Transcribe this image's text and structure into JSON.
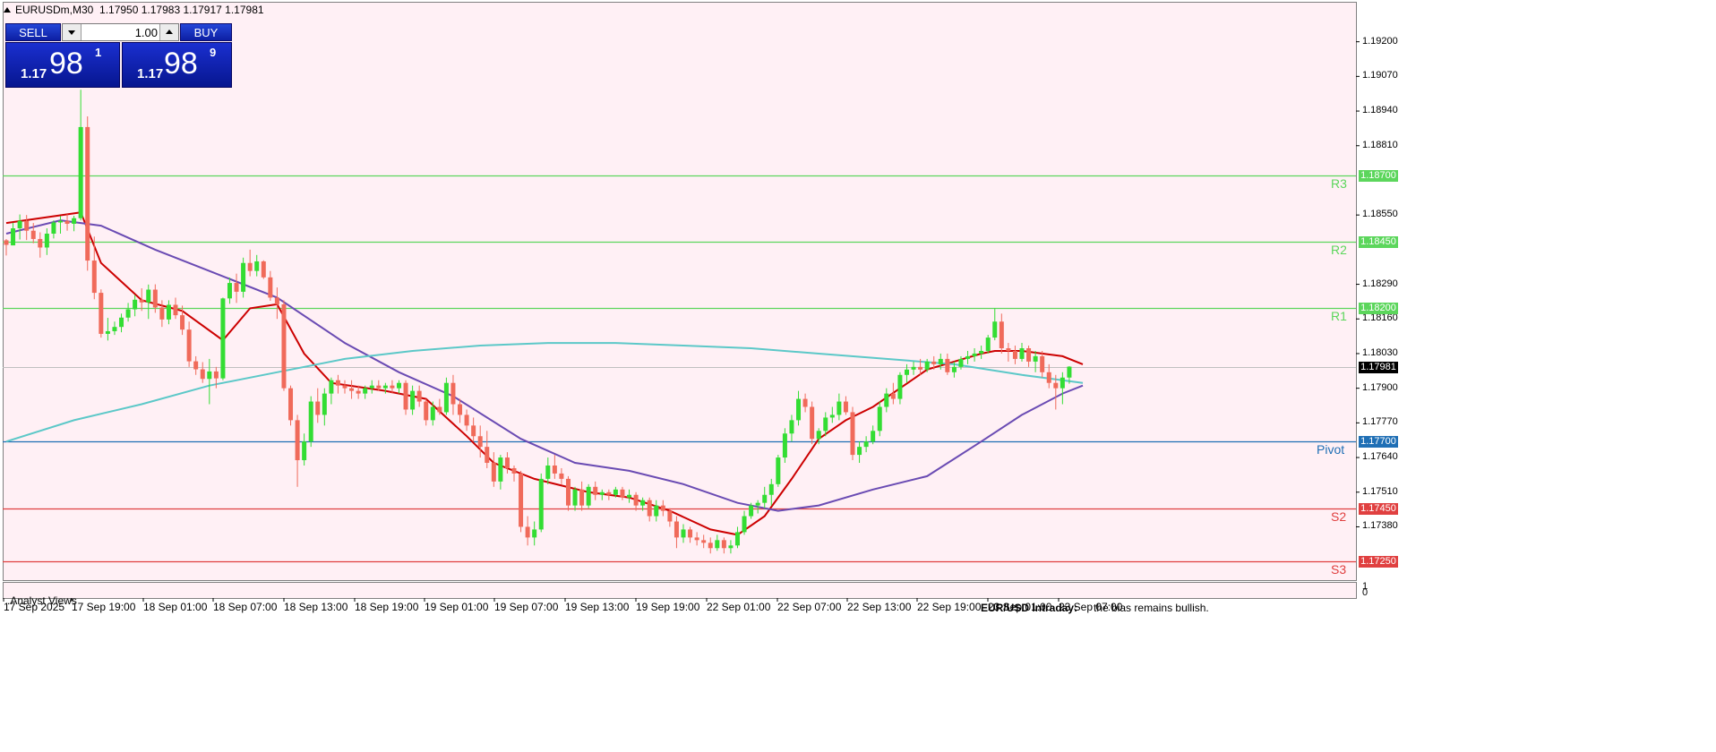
{
  "header": {
    "symbol": "EURUSDm,M30",
    "ohlc": "1.17950 1.17983 1.17917 1.17981"
  },
  "trade_panel": {
    "sell_label": "SELL",
    "buy_label": "BUY",
    "lot_value": "1.00",
    "sell_prefix": "1.17",
    "sell_big": "98",
    "sell_sup": "1",
    "buy_prefix": "1.17",
    "buy_big": "98",
    "buy_sup": "9"
  },
  "y_axis": {
    "ticks": [
      "1.19200",
      "1.19070",
      "1.18940",
      "1.18810",
      "1.18550",
      "1.18290",
      "1.18160",
      "1.18030",
      "1.17900",
      "1.17770",
      "1.17640",
      "1.17510",
      "1.17380"
    ],
    "current_price": "1.17981",
    "sub_ticks": [
      "1",
      "0"
    ]
  },
  "levels": [
    {
      "name": "R3",
      "price": "1.18700",
      "value": 1.187,
      "color": "#5cd65c"
    },
    {
      "name": "R2",
      "price": "1.18450",
      "value": 1.1845,
      "color": "#5cd65c"
    },
    {
      "name": "R1",
      "price": "1.18200",
      "value": 1.182,
      "color": "#5cd65c"
    },
    {
      "name": "Pivot",
      "price": "1.17700",
      "value": 1.177,
      "color": "#1f6fb5"
    },
    {
      "name": "S2",
      "price": "1.17450",
      "value": 1.1745,
      "color": "#e04040"
    },
    {
      "name": "S3",
      "price": "1.17250",
      "value": 1.1725,
      "color": "#e04040"
    }
  ],
  "x_axis": {
    "ticks": [
      "17 Sep 2025",
      "17 Sep 19:00",
      "18 Sep 01:00",
      "18 Sep 07:00",
      "18 Sep 13:00",
      "18 Sep 19:00",
      "19 Sep 01:00",
      "19 Sep 07:00",
      "19 Sep 13:00",
      "19 Sep 19:00",
      "22 Sep 01:00",
      "22 Sep 07:00",
      "22 Sep 13:00",
      "22 Sep 19:00",
      "23 Sep 01:00",
      "23 Sep 07:00"
    ]
  },
  "subwindow": {
    "title": ".Analyst Views",
    "news_title": "EUR/USD Intraday:",
    "news_text": "the bias remains bullish."
  },
  "colors": {
    "background": "#fff0f5",
    "bull": "#33dd33",
    "bear": "#f06a5a",
    "ma_fast": "#cc0000",
    "ma_mid": "#6a4bb3",
    "ma_slow": "#5cc8c8",
    "grid": "#c0c0c0"
  },
  "chart_data": {
    "type": "candlestick",
    "symbol": "EURUSDm",
    "timeframe": "M30",
    "ylim": [
      1.1718,
      1.1935
    ],
    "candles": [
      [
        1.18455,
        1.1846,
        1.18398,
        1.18438
      ],
      [
        1.18436,
        1.18521,
        1.18436,
        1.185
      ],
      [
        1.185,
        1.18552,
        1.18458,
        1.18528
      ],
      [
        1.18528,
        1.1855,
        1.18456,
        1.18491
      ],
      [
        1.18491,
        1.1852,
        1.18444,
        1.1846
      ],
      [
        1.1846,
        1.18485,
        1.1839,
        1.18428
      ],
      [
        1.18428,
        1.185,
        1.184,
        1.1848
      ],
      [
        1.1848,
        1.1853,
        1.18462,
        1.18522
      ],
      [
        1.18522,
        1.18546,
        1.1848,
        1.18528
      ],
      [
        1.18528,
        1.18553,
        1.18491,
        1.18517
      ],
      [
        1.18517,
        1.18547,
        1.18489,
        1.18538
      ],
      [
        1.18538,
        1.1902,
        1.1853,
        1.1888
      ],
      [
        1.1888,
        1.1892,
        1.18341,
        1.18379
      ],
      [
        1.18379,
        1.18469,
        1.18234,
        1.18258
      ],
      [
        1.18258,
        1.18271,
        1.1809,
        1.18104
      ],
      [
        1.18104,
        1.18164,
        1.18079,
        1.18114
      ],
      [
        1.18114,
        1.1815,
        1.181,
        1.1813
      ],
      [
        1.1813,
        1.1818,
        1.1811,
        1.18165
      ],
      [
        1.18165,
        1.1822,
        1.1815,
        1.18196
      ],
      [
        1.18196,
        1.1825,
        1.1817,
        1.18232
      ],
      [
        1.18232,
        1.18275,
        1.1819,
        1.18222
      ],
      [
        1.18222,
        1.18289,
        1.1816,
        1.1827
      ],
      [
        1.1827,
        1.1829,
        1.18183,
        1.18203
      ],
      [
        1.18203,
        1.1823,
        1.1813,
        1.18158
      ],
      [
        1.18158,
        1.1823,
        1.1814,
        1.18213
      ],
      [
        1.18213,
        1.1824,
        1.1816,
        1.18174
      ],
      [
        1.18174,
        1.1821,
        1.181,
        1.1812
      ],
      [
        1.1812,
        1.1815,
        1.1798,
        1.18001
      ],
      [
        1.18001,
        1.1802,
        1.1795,
        1.17971
      ],
      [
        1.17971,
        1.17998,
        1.1792,
        1.17935
      ],
      [
        1.17935,
        1.1801,
        1.1784,
        1.17963
      ],
      [
        1.17963,
        1.1798,
        1.179,
        1.17937
      ],
      [
        1.17937,
        1.1824,
        1.1793,
        1.18237
      ],
      [
        1.18237,
        1.18315,
        1.18217,
        1.18295
      ],
      [
        1.18295,
        1.1833,
        1.1822,
        1.18262
      ],
      [
        1.18262,
        1.1839,
        1.1824,
        1.1837
      ],
      [
        1.1837,
        1.1842,
        1.1832,
        1.1834
      ],
      [
        1.1834,
        1.184,
        1.1832,
        1.18376
      ],
      [
        1.18376,
        1.1838,
        1.1831,
        1.18316
      ],
      [
        1.18316,
        1.1834,
        1.18228,
        1.1824
      ],
      [
        1.1824,
        1.18278,
        1.1816,
        1.18215
      ],
      [
        1.18215,
        1.1823,
        1.1789,
        1.179
      ],
      [
        1.179,
        1.1791,
        1.1776,
        1.1778
      ],
      [
        1.1778,
        1.178,
        1.1753,
        1.1763
      ],
      [
        1.1763,
        1.1773,
        1.1761,
        1.177
      ],
      [
        1.177,
        1.1787,
        1.1768,
        1.1785
      ],
      [
        1.1785,
        1.179,
        1.1777,
        1.178
      ],
      [
        1.178,
        1.179,
        1.1776,
        1.1788
      ],
      [
        1.1788,
        1.1794,
        1.1784,
        1.1793
      ],
      [
        1.1793,
        1.1795,
        1.1788,
        1.1791
      ],
      [
        1.1791,
        1.1793,
        1.1788,
        1.179
      ],
      [
        1.179,
        1.1793,
        1.1786,
        1.1789
      ],
      [
        1.1789,
        1.1791,
        1.1786,
        1.1788
      ],
      [
        1.1788,
        1.1791,
        1.1786,
        1.179
      ],
      [
        1.179,
        1.1793,
        1.1788,
        1.1791
      ],
      [
        1.1791,
        1.1793,
        1.1789,
        1.179
      ],
      [
        1.179,
        1.1792,
        1.1788,
        1.1791
      ],
      [
        1.1791,
        1.1793,
        1.1788,
        1.179
      ],
      [
        1.179,
        1.1793,
        1.1788,
        1.1792
      ],
      [
        1.1792,
        1.1793,
        1.178,
        1.1782
      ],
      [
        1.1782,
        1.1791,
        1.178,
        1.1789
      ],
      [
        1.1789,
        1.1791,
        1.1783,
        1.1785
      ],
      [
        1.1785,
        1.1786,
        1.1776,
        1.1778
      ],
      [
        1.1778,
        1.1785,
        1.1776,
        1.1783
      ],
      [
        1.1783,
        1.1786,
        1.178,
        1.1781
      ],
      [
        1.1781,
        1.1794,
        1.178,
        1.1792
      ],
      [
        1.1792,
        1.1795,
        1.178,
        1.1784
      ],
      [
        1.1784,
        1.1786,
        1.1777,
        1.178
      ],
      [
        1.178,
        1.1782,
        1.1774,
        1.1776
      ],
      [
        1.1776,
        1.1779,
        1.177,
        1.1772
      ],
      [
        1.1772,
        1.1776,
        1.1764,
        1.1768
      ],
      [
        1.1768,
        1.1774,
        1.176,
        1.1762
      ],
      [
        1.1762,
        1.1766,
        1.1753,
        1.1755
      ],
      [
        1.1755,
        1.1765,
        1.1752,
        1.1764
      ],
      [
        1.1764,
        1.1766,
        1.1758,
        1.176
      ],
      [
        1.176,
        1.1761,
        1.1755,
        1.1758
      ],
      [
        1.1758,
        1.1759,
        1.1736,
        1.1738
      ],
      [
        1.1738,
        1.1742,
        1.1731,
        1.1734
      ],
      [
        1.1734,
        1.174,
        1.1731,
        1.1737
      ],
      [
        1.1737,
        1.1758,
        1.1736,
        1.1756
      ],
      [
        1.1756,
        1.1764,
        1.1754,
        1.1761
      ],
      [
        1.1761,
        1.1765,
        1.1756,
        1.1758
      ],
      [
        1.1758,
        1.176,
        1.1754,
        1.1756
      ],
      [
        1.1756,
        1.1757,
        1.1744,
        1.1746
      ],
      [
        1.1746,
        1.1753,
        1.1744,
        1.1752
      ],
      [
        1.1752,
        1.1755,
        1.1744,
        1.1746
      ],
      [
        1.1746,
        1.1754,
        1.1745,
        1.1753
      ],
      [
        1.1753,
        1.1755,
        1.1748,
        1.175
      ],
      [
        1.175,
        1.1752,
        1.1748,
        1.1751
      ],
      [
        1.1751,
        1.1752,
        1.1748,
        1.175
      ],
      [
        1.175,
        1.1753,
        1.1749,
        1.1752
      ],
      [
        1.1752,
        1.1753,
        1.1748,
        1.1749
      ],
      [
        1.1749,
        1.1752,
        1.1747,
        1.175
      ],
      [
        1.175,
        1.1751,
        1.1744,
        1.1746
      ],
      [
        1.1746,
        1.1749,
        1.1744,
        1.1748
      ],
      [
        1.1748,
        1.1749,
        1.174,
        1.1742
      ],
      [
        1.1742,
        1.1748,
        1.174,
        1.1746
      ],
      [
        1.1746,
        1.1748,
        1.1742,
        1.1744
      ],
      [
        1.1744,
        1.1745,
        1.1738,
        1.174
      ],
      [
        1.174,
        1.1742,
        1.173,
        1.1734
      ],
      [
        1.1734,
        1.1739,
        1.1732,
        1.1737
      ],
      [
        1.1737,
        1.1738,
        1.1732,
        1.1734
      ],
      [
        1.1734,
        1.1736,
        1.1731,
        1.1733
      ],
      [
        1.1733,
        1.1735,
        1.173,
        1.1732
      ],
      [
        1.1732,
        1.1734,
        1.1728,
        1.173
      ],
      [
        1.173,
        1.1735,
        1.1729,
        1.1733
      ],
      [
        1.1733,
        1.1734,
        1.1728,
        1.173
      ],
      [
        1.173,
        1.1733,
        1.1728,
        1.1731
      ],
      [
        1.1731,
        1.1738,
        1.173,
        1.1736
      ],
      [
        1.1736,
        1.1744,
        1.1735,
        1.1742
      ],
      [
        1.1742,
        1.1747,
        1.1741,
        1.1746
      ],
      [
        1.1746,
        1.1748,
        1.1743,
        1.1747
      ],
      [
        1.1747,
        1.1753,
        1.1745,
        1.175
      ],
      [
        1.175,
        1.1756,
        1.1746,
        1.1754
      ],
      [
        1.1754,
        1.1765,
        1.1753,
        1.1764
      ],
      [
        1.1764,
        1.1775,
        1.1762,
        1.1773
      ],
      [
        1.1773,
        1.178,
        1.177,
        1.1778
      ],
      [
        1.1778,
        1.1789,
        1.1776,
        1.1786
      ],
      [
        1.1786,
        1.1788,
        1.1781,
        1.1783
      ],
      [
        1.1783,
        1.1785,
        1.1769,
        1.1771
      ],
      [
        1.1771,
        1.1775,
        1.1769,
        1.1774
      ],
      [
        1.1774,
        1.1781,
        1.1772,
        1.1779
      ],
      [
        1.1779,
        1.1783,
        1.1777,
        1.178
      ],
      [
        1.178,
        1.1788,
        1.1778,
        1.1785
      ],
      [
        1.1785,
        1.1787,
        1.178,
        1.1781
      ],
      [
        1.1781,
        1.1783,
        1.1763,
        1.1765
      ],
      [
        1.1765,
        1.177,
        1.1762,
        1.1768
      ],
      [
        1.1768,
        1.1772,
        1.1766,
        1.177
      ],
      [
        1.177,
        1.1776,
        1.1769,
        1.1774
      ],
      [
        1.1774,
        1.1785,
        1.1772,
        1.1783
      ],
      [
        1.1783,
        1.179,
        1.1781,
        1.1788
      ],
      [
        1.1788,
        1.1792,
        1.1784,
        1.1786
      ],
      [
        1.1786,
        1.1796,
        1.1784,
        1.1795
      ],
      [
        1.1795,
        1.1799,
        1.1792,
        1.1797
      ],
      [
        1.1797,
        1.18,
        1.1795,
        1.1798
      ],
      [
        1.1798,
        1.1801,
        1.1795,
        1.1797
      ],
      [
        1.1797,
        1.1801,
        1.1796,
        1.18
      ],
      [
        1.18,
        1.1802,
        1.1797,
        1.1799
      ],
      [
        1.1799,
        1.1803,
        1.1797,
        1.1801
      ],
      [
        1.1801,
        1.1803,
        1.1795,
        1.1796
      ],
      [
        1.1796,
        1.18,
        1.1794,
        1.1798
      ],
      [
        1.1798,
        1.1802,
        1.1797,
        1.1801
      ],
      [
        1.1801,
        1.1804,
        1.1799,
        1.1802
      ],
      [
        1.1802,
        1.1805,
        1.18,
        1.1803
      ],
      [
        1.1803,
        1.1806,
        1.1801,
        1.1804
      ],
      [
        1.1804,
        1.181,
        1.1803,
        1.1809
      ],
      [
        1.1809,
        1.182,
        1.1808,
        1.1815
      ],
      [
        1.1815,
        1.1818,
        1.1803,
        1.1805
      ],
      [
        1.1805,
        1.1807,
        1.18,
        1.1804
      ],
      [
        1.1804,
        1.1806,
        1.1799,
        1.1801
      ],
      [
        1.1801,
        1.1807,
        1.18,
        1.1805
      ],
      [
        1.1805,
        1.1806,
        1.1798,
        1.18
      ],
      [
        1.18,
        1.1804,
        1.1796,
        1.1802
      ],
      [
        1.1802,
        1.1804,
        1.1794,
        1.1796
      ],
      [
        1.1796,
        1.1799,
        1.179,
        1.1792
      ],
      [
        1.1792,
        1.1795,
        1.1782,
        1.179
      ],
      [
        1.179,
        1.1796,
        1.1784,
        1.1794
      ],
      [
        1.1794,
        1.17983,
        1.17917,
        1.17981
      ]
    ],
    "moving_averages": [
      {
        "color": "#cc0000",
        "points": [
          [
            0,
            1.1852
          ],
          [
            11,
            1.1856
          ],
          [
            14,
            1.1837
          ],
          [
            20,
            1.1823
          ],
          [
            26,
            1.1819
          ],
          [
            32,
            1.1808
          ],
          [
            36,
            1.182
          ],
          [
            40,
            1.18215
          ],
          [
            44,
            1.1803
          ],
          [
            48,
            1.1792
          ],
          [
            56,
            1.1789
          ],
          [
            62,
            1.1786
          ],
          [
            68,
            1.1772
          ],
          [
            72,
            1.1762
          ],
          [
            78,
            1.1756
          ],
          [
            86,
            1.1751
          ],
          [
            92,
            1.1749
          ],
          [
            98,
            1.1744
          ],
          [
            104,
            1.1737
          ],
          [
            108,
            1.1735
          ],
          [
            112,
            1.1742
          ],
          [
            116,
            1.1756
          ],
          [
            120,
            1.1771
          ],
          [
            124,
            1.1778
          ],
          [
            128,
            1.1783
          ],
          [
            132,
            1.179
          ],
          [
            136,
            1.1797
          ],
          [
            140,
            1.18
          ],
          [
            144,
            1.1803
          ],
          [
            146,
            1.1804
          ],
          [
            150,
            1.1804
          ],
          [
            156,
            1.1802
          ],
          [
            159,
            1.1799
          ]
        ]
      },
      {
        "color": "#6a4bb3",
        "points": [
          [
            0,
            1.1848
          ],
          [
            8,
            1.1853
          ],
          [
            14,
            1.1851
          ],
          [
            22,
            1.1842
          ],
          [
            30,
            1.1834
          ],
          [
            40,
            1.1824
          ],
          [
            50,
            1.1807
          ],
          [
            58,
            1.1796
          ],
          [
            66,
            1.1787
          ],
          [
            76,
            1.1771
          ],
          [
            84,
            1.1762
          ],
          [
            92,
            1.1759
          ],
          [
            100,
            1.1754
          ],
          [
            108,
            1.1747
          ],
          [
            114,
            1.1744
          ],
          [
            120,
            1.1746
          ],
          [
            128,
            1.1752
          ],
          [
            136,
            1.1757
          ],
          [
            144,
            1.177
          ],
          [
            150,
            1.178
          ],
          [
            156,
            1.1788
          ],
          [
            159,
            1.1791
          ]
        ]
      },
      {
        "color": "#5cc8c8",
        "points": [
          [
            0,
            1.177
          ],
          [
            10,
            1.1778
          ],
          [
            20,
            1.1784
          ],
          [
            30,
            1.1791
          ],
          [
            40,
            1.1796
          ],
          [
            50,
            1.1801
          ],
          [
            60,
            1.1804
          ],
          [
            70,
            1.1806
          ],
          [
            80,
            1.1807
          ],
          [
            90,
            1.1807
          ],
          [
            100,
            1.1806
          ],
          [
            110,
            1.1805
          ],
          [
            120,
            1.1803
          ],
          [
            130,
            1.1801
          ],
          [
            140,
            1.1799
          ],
          [
            150,
            1.1795
          ],
          [
            156,
            1.1793
          ],
          [
            159,
            1.1792
          ]
        ]
      }
    ]
  }
}
